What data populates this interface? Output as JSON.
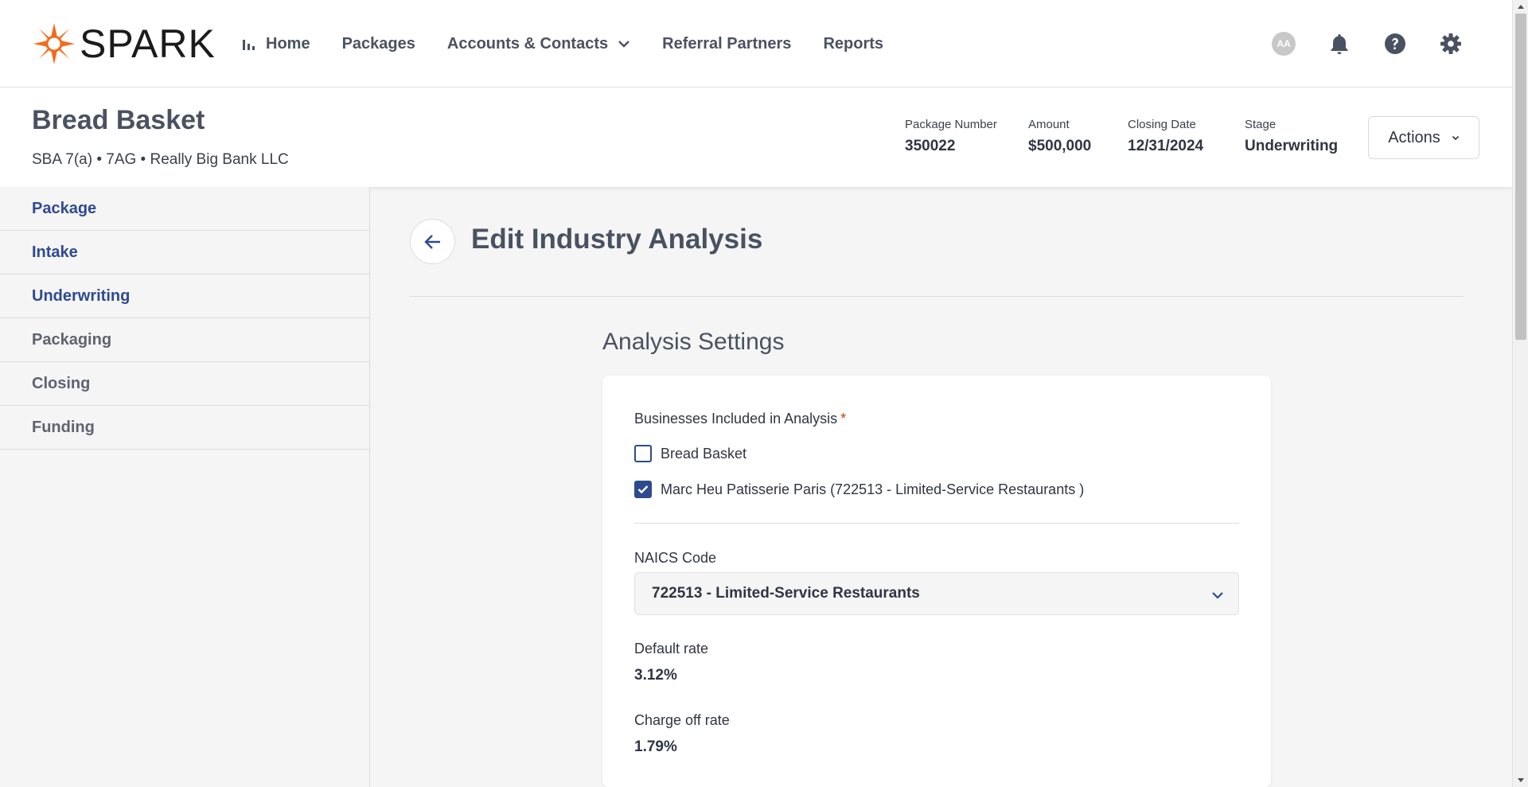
{
  "brand": {
    "name": "SPARK",
    "accent": "#f26b1d"
  },
  "nav": {
    "home": "Home",
    "packages": "Packages",
    "accounts": "Accounts & Contacts",
    "referral": "Referral Partners",
    "reports": "Reports",
    "avatar_initials": "AA"
  },
  "package": {
    "name": "Bread Basket",
    "subtitle": "SBA 7(a) • 7AG • Really Big Bank LLC",
    "number_label": "Package Number",
    "number": "350022",
    "amount_label": "Amount",
    "amount": "$500,000",
    "closing_label": "Closing Date",
    "closing": "12/31/2024",
    "stage_label": "Stage",
    "stage": "Underwriting",
    "actions": "Actions"
  },
  "sidebar": {
    "items": [
      {
        "label": "Package"
      },
      {
        "label": "Intake"
      },
      {
        "label": "Underwriting"
      },
      {
        "label": "Packaging"
      },
      {
        "label": "Closing"
      },
      {
        "label": "Funding"
      }
    ]
  },
  "main": {
    "title": "Edit Industry Analysis",
    "section_title": "Analysis Settings",
    "businesses_label": "Businesses Included in Analysis",
    "required_mark": "*",
    "businesses": [
      {
        "label": "Bread Basket",
        "checked": false
      },
      {
        "label": "Marc Heu Patisserie Paris (722513 - Limited-Service Restaurants )",
        "checked": true
      }
    ],
    "naics_label": "NAICS Code",
    "naics_value": "722513 - Limited-Service Restaurants",
    "default_rate_label": "Default rate",
    "default_rate": "3.12%",
    "charge_off_label": "Charge off rate",
    "charge_off": "1.79%"
  },
  "icons": {
    "chart": "bar-chart-icon",
    "bell": "bell-icon",
    "help": "help-icon",
    "settings": "gear-icon",
    "back": "arrow-left-icon"
  }
}
